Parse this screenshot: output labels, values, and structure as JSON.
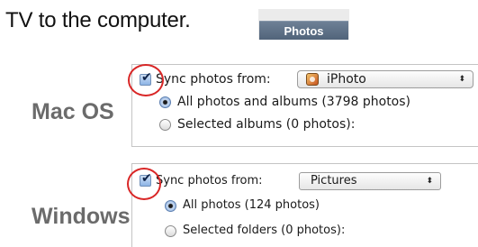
{
  "intro_text": "TV to the computer.",
  "photos_tab": {
    "label": "Photos"
  },
  "mac": {
    "os_label": "Mac OS",
    "sync_label": "Sync photos from:",
    "sync_checked": true,
    "source_value": "iPhoto",
    "source_icon": "iphoto-icon",
    "option_all": "All photos and albums (3798 photos)",
    "option_selected": "Selected albums (0 photos):",
    "selected_option": "all"
  },
  "windows": {
    "os_label": "Windows",
    "sync_label": "Sync photos from:",
    "sync_checked": true,
    "source_value": "Pictures",
    "option_all": "All photos (124 photos)",
    "option_selected": "Selected folders (0 photos):",
    "selected_option": "all"
  },
  "colors": {
    "highlight_circle": "#d92626",
    "os_label": "#6b6b6b",
    "tab_background": "#5a6d84"
  }
}
